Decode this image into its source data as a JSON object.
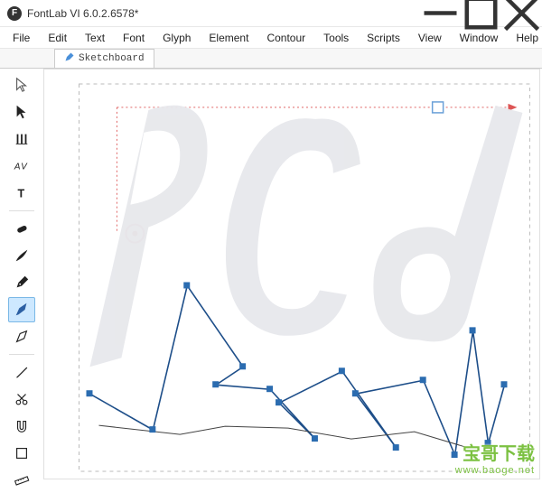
{
  "titlebar": {
    "app_icon_letter": "F",
    "title": "FontLab VI 6.0.2.6578*"
  },
  "menu": {
    "items": [
      "File",
      "Edit",
      "Text",
      "Font",
      "Glyph",
      "Element",
      "Contour",
      "Tools",
      "Scripts",
      "View",
      "Window",
      "Help"
    ]
  },
  "tab": {
    "label": "Sketchboard"
  },
  "tools": [
    {
      "name": "select-arrow",
      "active": false
    },
    {
      "name": "direct-select",
      "active": false
    },
    {
      "name": "metrics-tool",
      "active": false
    },
    {
      "name": "av-kerning",
      "active": false
    },
    {
      "name": "text-tool",
      "active": false
    },
    {
      "name": "eraser-tool",
      "active": false
    },
    {
      "name": "brush-tool",
      "active": false
    },
    {
      "name": "pen-tool",
      "active": false
    },
    {
      "name": "rapid-pen",
      "active": true
    },
    {
      "name": "calligraphy-pen",
      "active": false
    },
    {
      "name": "knife-tool",
      "active": false
    },
    {
      "name": "scissors-tool",
      "active": false
    },
    {
      "name": "magnet-tool",
      "active": false
    },
    {
      "name": "shape-tool",
      "active": false
    },
    {
      "name": "measure-tool",
      "active": false
    }
  ],
  "watermark": {
    "line1": "宝哥下载",
    "line2": "www.baoge.net"
  }
}
